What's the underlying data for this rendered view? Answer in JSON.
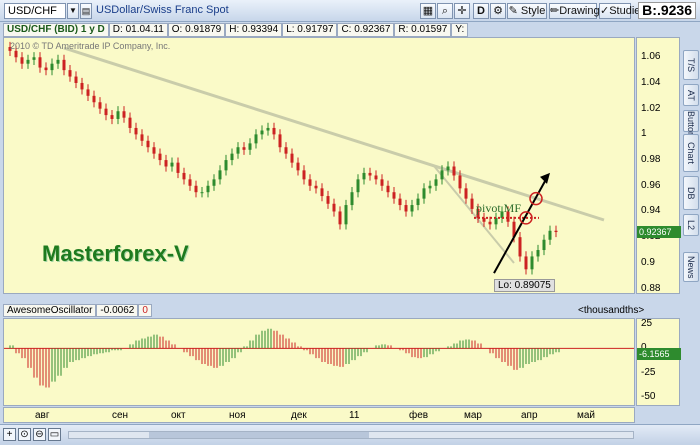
{
  "toolbar": {
    "symbol": "USD/CHF",
    "description": "USDollar/Swiss Franc Spot",
    "d_button": "D",
    "style_button": "Style",
    "drawings_button": "Drawings",
    "studies_button": "Studies",
    "price_prefix": "B:",
    "price": ".9236"
  },
  "infobar": {
    "symbol_period": "USD/CHF (BID) 1 y D",
    "date": "D: 01.04.11",
    "open": "O: 0.91879",
    "high": "H: 0.93394",
    "low": "L: 0.91797",
    "close": "C: 0.92367",
    "range": "R: 0.01597",
    "y": "Y:"
  },
  "main": {
    "copyright": "2010 © TD Ameritrade IP Company, Inc.",
    "watermark": "Masterforex-V",
    "pivot_label": "pivot MF",
    "low_label": "Lo: 0.89075",
    "last_price": "0.92367",
    "price_ticks": [
      "1.06",
      "1.04",
      "1.02",
      "1",
      "0.98",
      "0.96",
      "0.94",
      "0.92",
      "0.9",
      "0.88"
    ]
  },
  "oscillator": {
    "name": "AwesomeOscillator",
    "value": "-0.0062",
    "zero": "0",
    "units": "<thousandths>",
    "last_value": "-6.1565",
    "ticks": [
      "25",
      "0",
      "-25",
      "-50"
    ]
  },
  "time_axis": [
    "авг",
    "сен",
    "окт",
    "ноя",
    "дек",
    "11",
    "фев",
    "мар",
    "апр",
    "май"
  ],
  "side_tabs": [
    "T/S",
    "AT",
    "Buttons",
    "Chart",
    "DB",
    "L2",
    "News"
  ],
  "chart_data": {
    "type": "candlestick",
    "x_range": [
      "авг",
      "май"
    ],
    "ylim": [
      0.875,
      1.075
    ],
    "closes": [
      1.065,
      1.06,
      1.055,
      1.058,
      1.06,
      1.052,
      1.05,
      1.055,
      1.058,
      1.05,
      1.045,
      1.04,
      1.035,
      1.03,
      1.025,
      1.02,
      1.015,
      1.012,
      1.018,
      1.013,
      1.005,
      1.0,
      0.995,
      0.99,
      0.985,
      0.98,
      0.975,
      0.978,
      0.97,
      0.965,
      0.96,
      0.955,
      0.955,
      0.96,
      0.965,
      0.972,
      0.98,
      0.985,
      0.99,
      0.988,
      0.993,
      1.0,
      1.003,
      1.005,
      1.0,
      0.99,
      0.985,
      0.978,
      0.972,
      0.965,
      0.96,
      0.958,
      0.952,
      0.946,
      0.94,
      0.93,
      0.945,
      0.955,
      0.965,
      0.97,
      0.968,
      0.965,
      0.96,
      0.955,
      0.95,
      0.945,
      0.94,
      0.945,
      0.95,
      0.958,
      0.96,
      0.965,
      0.972,
      0.975,
      0.968,
      0.958,
      0.95,
      0.942,
      0.935,
      0.932,
      0.93,
      0.935,
      0.94,
      0.932,
      0.92,
      0.905,
      0.895,
      0.905,
      0.91,
      0.918,
      0.925,
      0.924
    ],
    "ao": [
      3,
      -5,
      -10,
      -20,
      -30,
      -38,
      -40,
      -34,
      -28,
      -20,
      -14,
      -12,
      -10,
      -8,
      -6,
      -5,
      -4,
      -2,
      -2,
      0,
      4,
      8,
      10,
      12,
      14,
      12,
      8,
      4,
      0,
      -4,
      -8,
      -12,
      -16,
      -18,
      -20,
      -18,
      -14,
      -10,
      -4,
      2,
      8,
      14,
      18,
      20,
      18,
      14,
      10,
      6,
      2,
      -2,
      -6,
      -10,
      -14,
      -16,
      -18,
      -19,
      -16,
      -12,
      -8,
      -4,
      0,
      3,
      4,
      3,
      0,
      -2,
      -5,
      -9,
      -10,
      -9,
      -6,
      -3,
      0,
      2,
      5,
      8,
      9,
      8,
      5,
      0,
      -5,
      -10,
      -14,
      -18,
      -22,
      -20,
      -16,
      -14,
      -12,
      -9,
      -6,
      -4
    ]
  },
  "colors": {
    "up": "#2e8b2e",
    "down": "#cc2222",
    "chart_bg": "#fafac8",
    "trendline": "#c9ccaa",
    "pivot_line": "#cc2222",
    "arrow": "#000000"
  }
}
